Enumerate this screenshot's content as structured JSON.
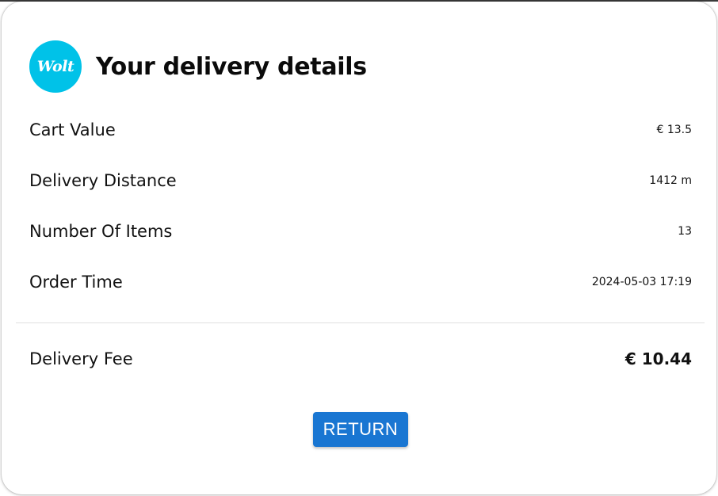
{
  "logo": {
    "text": "Wolt",
    "color": "#00c2e8"
  },
  "header": {
    "title": "Your delivery details"
  },
  "details": [
    {
      "label": "Cart Value",
      "value": "€ 13.5"
    },
    {
      "label": "Delivery Distance",
      "value": "1412 m"
    },
    {
      "label": "Number Of Items",
      "value": "13"
    },
    {
      "label": "Order Time",
      "value": "2024-05-03 17:19"
    }
  ],
  "fee": {
    "label": "Delivery Fee",
    "value": "€ 10.44"
  },
  "actions": {
    "return_label": "RETURN",
    "return_color": "#1976d2"
  }
}
